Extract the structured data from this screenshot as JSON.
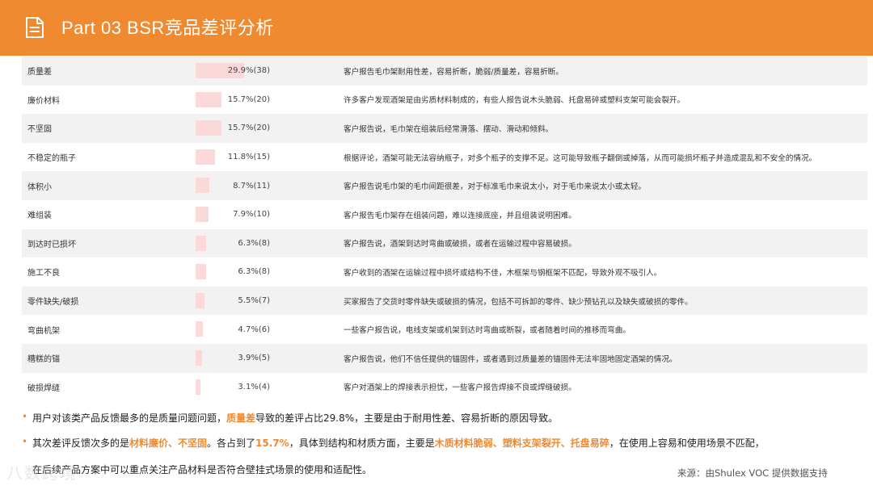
{
  "header": {
    "title": "Part 03   BSR竞品差评分析",
    "background_color": "#f08a30",
    "icon": "document-icon"
  },
  "table": {
    "rows": [
      {
        "name": "质量差",
        "pct": "29.9%(38)",
        "value": 29.9,
        "desc": "客户报告毛巾架耐用性差，容易折断，脆弱/质量差，容易折断。"
      },
      {
        "name": "廉价材料",
        "pct": "15.7%(20)",
        "value": 15.7,
        "desc": "许多客户发现酒架是由劣质材料制成的，有些人报告说木头脆弱、托盘易碎或塑料支架可能会裂开。"
      },
      {
        "name": "不坚固",
        "pct": "15.7%(20)",
        "value": 15.7,
        "desc": "客户报告说，毛巾架在组装后经常滑落、摆动、滑动和倾斜。"
      },
      {
        "name": "不稳定的瓶子",
        "pct": "11.8%(15)",
        "value": 11.8,
        "desc": "根据评论，酒架可能无法容纳瓶子，对多个瓶子的支撑不足。这可能导致瓶子翻倒或掉落，从而可能损坏瓶子并造成混乱和不安全的情况。"
      },
      {
        "name": "体积小",
        "pct": "8.7%(11)",
        "value": 8.7,
        "desc": "客户报告说毛巾架的毛巾间距很差，对于标准毛巾来说太小，对于毛巾来说太小或太轻。"
      },
      {
        "name": "难组装",
        "pct": "7.9%(10)",
        "value": 7.9,
        "desc": "客户报告毛巾架存在组装问题，难以连接底座，并且组装说明困难。"
      },
      {
        "name": "到达时已损坏",
        "pct": "6.3%(8)",
        "value": 6.3,
        "desc": "客户报告说，酒架到达时弯曲或破损，或者在运输过程中容易破损。"
      },
      {
        "name": "施工不良",
        "pct": "6.3%(8)",
        "value": 6.3,
        "desc": "客户收到的酒架在运输过程中损坏或结构不佳，木框架与钢框架不匹配，导致外观不吸引人。"
      },
      {
        "name": "零件缺失/破损",
        "pct": "5.5%(7)",
        "value": 5.5,
        "desc": "买家报告了交货时零件缺失或破损的情况，包括不可拆卸的零件、缺少预钻孔以及缺失或破损的零件。"
      },
      {
        "name": "弯曲机架",
        "pct": "4.7%(6)",
        "value": 4.7,
        "desc": "一些客户报告说，电线支架或机架到达时弯曲或断裂，或者随着时间的推移而弯曲。"
      },
      {
        "name": "糟糕的锚",
        "pct": "3.9%(5)",
        "value": 3.9,
        "desc": "客户报告说，他们不信任提供的锚固件，或者遇到过质量差的锚固件无法牢固地固定酒架的情况。"
      },
      {
        "name": "破损焊缝",
        "pct": "3.1%(4)",
        "value": 3.1,
        "desc": "客户对酒架上的焊接表示担忧，一些客户报告焊接不良或焊缝破损。"
      }
    ]
  },
  "summary": {
    "bullet": "•",
    "line1_a": "用户对该类产品反馈最多的是质量问题问题，",
    "line1_hl": "质量差",
    "line1_b": "导致的差评占比29.8%，主要是由于耐用性差、容易折断的原因导致。",
    "line2_a": "其次差评反馈次多的是",
    "line2_hl1": "材料廉价、不坚固",
    "line2_b": "。各占到了",
    "line2_hl2": "15.7%",
    "line2_c": "，具体到结构和材质方面，主要是",
    "line2_hl3": "木质材料脆弱、塑料支架裂开、托盘易碎",
    "line2_d": "，在使用上容易和使用场景不匹配，",
    "line3": "在后续产品方案中可以重点关注产品材料是否符合壁挂式场景的使用和适配性。"
  },
  "source": "来源：由Shulex VOC 提供数据支持",
  "watermark": "八数跨境"
}
